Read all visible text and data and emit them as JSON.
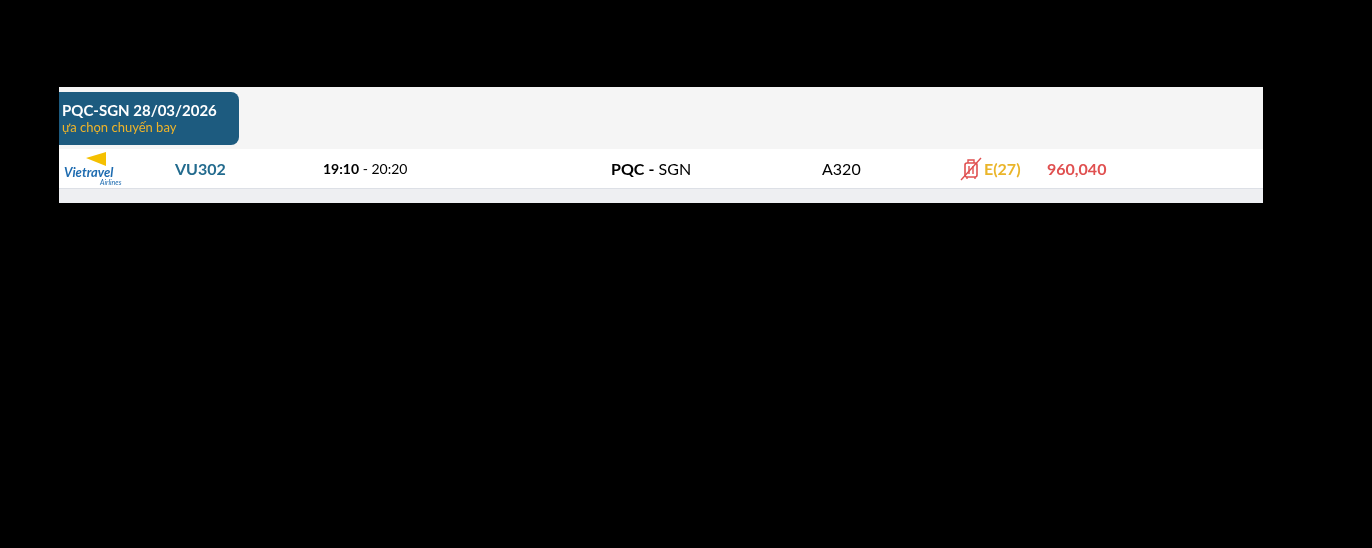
{
  "tab": {
    "title": "PQC-SGN 28/03/2026",
    "subtitle": "ựa chọn chuyến bay"
  },
  "flights": [
    {
      "logo": {
        "name": "Vietravel",
        "sub": "Airlines"
      },
      "flight_no": "VU302",
      "depart": "19:10",
      "separator": "-",
      "arrive": "20:20",
      "from": "PQC",
      "route_sep": "-",
      "to": "SGN",
      "aircraft": "A320",
      "baggage_included": false,
      "fare_class": "E(27)",
      "price": "960,040"
    }
  ]
}
